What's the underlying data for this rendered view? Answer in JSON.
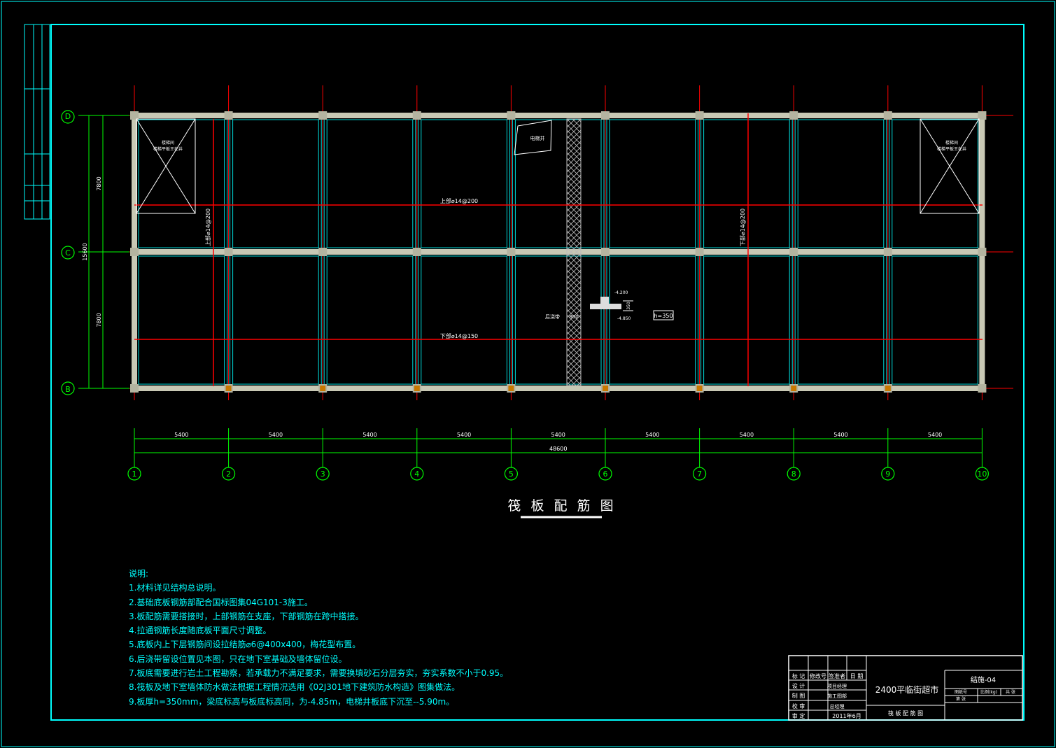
{
  "drawing": {
    "title": "筏 板 配 筋 图",
    "axes_letters": [
      "D",
      "C",
      "B"
    ],
    "axes_numbers": [
      "1",
      "2",
      "3",
      "4",
      "5",
      "6",
      "7",
      "8",
      "9",
      "10"
    ],
    "bay_dims": [
      "5400",
      "5400",
      "5400",
      "5400",
      "5400",
      "5400",
      "5400",
      "5400",
      "5400"
    ],
    "total_dim": "48600",
    "vert_dims": [
      "7800",
      "7800"
    ],
    "vert_total": "15600",
    "rebar_labels": {
      "top_horizontal": "上部⌀14@200",
      "bottom_horizontal": "下部⌀14@150",
      "top_vertical": "上部⌀14@200",
      "bottom_vertical": "下部⌀14@200"
    },
    "stair_labels": [
      "楼梯间\n楼梯平板王在井",
      "楼梯间\n楼梯平板王在井"
    ],
    "elevator_label": "电梯井",
    "post_pour_label": "后浇带",
    "post_pour_width": "800",
    "section_levels": [
      "-4.200",
      "-4.850"
    ],
    "section_dim": "350",
    "thickness_tag": "h=350"
  },
  "notes": {
    "heading": "说明:",
    "items": [
      "1.材料详见结构总说明。",
      "2.基础底板钢筋部配合国标图集04G101-3施工。",
      "3.板配筋需要搭接时，上部钢筋在支座，下部钢筋在跨中搭接。",
      "4.拉通钢筋长度随底板平面尺寸调整。",
      "5.底板内上下层钢筋间设拉结筋⌀6@400x400，梅花型布置。",
      "6.后浇带留设位置见本图，只在地下室基础及墙体留位设。",
      "7.板底需要进行岩土工程勘察，若承载力不满足要求，需要换填砂石分层夯实，夯实系数不小于0.95。",
      "8.筏板及地下室墙体防水做法根据工程情况选用《02J301地下建筑防水构造》图集做法。",
      "9.板厚h=350mm，梁底标高与板底标高同，为-4.85m，电梯井板底下沉至--5.90m。"
    ]
  },
  "title_block": {
    "project": "2400平临街超市",
    "drawing_no": "结施-04",
    "sheet_name": "筏 板 配 筋 图",
    "date": "2011年6月",
    "row_labels": [
      "标 记",
      "设 计",
      "制 图",
      "校 审",
      "审 定",
      "审 定"
    ],
    "header_cells": [
      "修改号",
      "签准者",
      "日 期"
    ],
    "names": [
      "项目经理",
      "施工图部",
      "总经理"
    ],
    "sub_cells": [
      "图纸号",
      "比例(kg)",
      "共 张",
      "第 张"
    ]
  },
  "colors": {
    "frame": "#00ffff",
    "grid": "#ff0000",
    "beam": "#c8c8b4",
    "dimension": "#00ff00",
    "text": "#ffffff"
  }
}
